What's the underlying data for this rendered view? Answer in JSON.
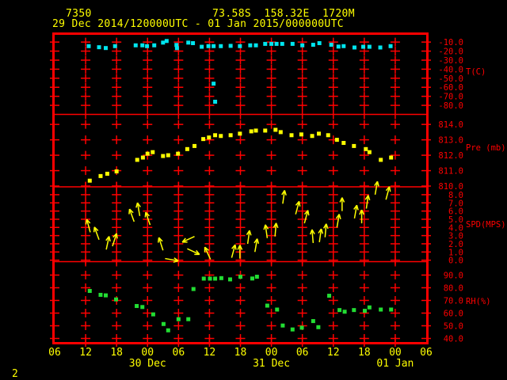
{
  "header": {
    "station_id": "7350",
    "location": "73.58S  158.32E  1720M",
    "period": "29 Dec 2014/120000UTC - 01 Jan 2015/000000UTC"
  },
  "footer": {
    "page_number": "2"
  },
  "colors": {
    "frame": "#ff0000",
    "axis_text": "#ff0000",
    "header_text": "#ffff00",
    "temperature_dots": "#00e5ee",
    "pressure_dots": "#ffff00",
    "wind_arrows": "#ffff00",
    "rh_dots": "#22dd33"
  },
  "x_axis": {
    "hours_span": 72,
    "tick_step_hours": 6,
    "tick_labels": [
      "06",
      "12",
      "18",
      "00",
      "06",
      "12",
      "18",
      "00",
      "06",
      "12",
      "18",
      "00",
      "06"
    ],
    "date_labels": [
      {
        "label": "30 Dec",
        "tick_index": 3
      },
      {
        "label": "31 Dec",
        "tick_index": 7
      },
      {
        "label": "01 Jan",
        "tick_index": 11
      }
    ]
  },
  "chart_data": [
    {
      "type": "scatter",
      "name": "temperature",
      "ylabel": "T(C)",
      "yticks": [
        -10,
        -20,
        -30,
        -40,
        -50,
        -60,
        -70,
        -80
      ],
      "ylim": [
        -2,
        -90
      ],
      "points": [
        [
          6.6,
          -14.5
        ],
        [
          8.6,
          -15.7
        ],
        [
          9.9,
          -16.6
        ],
        [
          11.7,
          -14.5
        ],
        [
          15.7,
          -13.6
        ],
        [
          17.0,
          -13.6
        ],
        [
          17.9,
          -14.5
        ],
        [
          19.3,
          -13.6
        ],
        [
          21.0,
          -10.6
        ],
        [
          21.7,
          -8.8
        ],
        [
          23.6,
          -13.2
        ],
        [
          23.7,
          -16.7
        ],
        [
          25.9,
          -10.6
        ],
        [
          26.8,
          -11.2
        ],
        [
          28.5,
          -15.2
        ],
        [
          29.8,
          -14.5
        ],
        [
          30.8,
          -14.5
        ],
        [
          32.2,
          -14.5
        ],
        [
          34.1,
          -14.2
        ],
        [
          35.9,
          -14.5
        ],
        [
          37.9,
          -13.6
        ],
        [
          39.0,
          -13.6
        ],
        [
          40.8,
          -12.0
        ],
        [
          42.0,
          -12.0
        ],
        [
          43.0,
          -12.0
        ],
        [
          44.1,
          -12.0
        ],
        [
          46.1,
          -12.0
        ],
        [
          48.0,
          -13.6
        ],
        [
          50.1,
          -13.0
        ],
        [
          51.3,
          -11.2
        ],
        [
          53.6,
          -13.0
        ],
        [
          55.0,
          -15.0
        ],
        [
          56.0,
          -14.5
        ],
        [
          58.1,
          -16.0
        ],
        [
          59.8,
          -15.2
        ],
        [
          61.0,
          -15.2
        ],
        [
          63.1,
          -16.0
        ],
        [
          65.1,
          -14.5
        ],
        [
          30.8,
          -56.0
        ],
        [
          31.1,
          -76.0
        ]
      ]
    },
    {
      "type": "scatter",
      "name": "pressure",
      "ylabel": "Pre (mb)",
      "yticks": [
        814,
        813,
        812,
        811,
        810
      ],
      "ylim": [
        814.65,
        809.95
      ],
      "points": [
        [
          6.8,
          810.35
        ],
        [
          8.9,
          810.65
        ],
        [
          10.2,
          810.8
        ],
        [
          12.0,
          810.95
        ],
        [
          16.0,
          811.7
        ],
        [
          17.1,
          811.85
        ],
        [
          18.0,
          812.1
        ],
        [
          19.0,
          812.2
        ],
        [
          21.0,
          811.95
        ],
        [
          22.0,
          812.0
        ],
        [
          23.9,
          812.1
        ],
        [
          25.7,
          812.4
        ],
        [
          27.1,
          812.6
        ],
        [
          28.8,
          813.05
        ],
        [
          29.9,
          813.15
        ],
        [
          31.1,
          813.3
        ],
        [
          32.2,
          813.25
        ],
        [
          34.1,
          813.3
        ],
        [
          35.9,
          813.4
        ],
        [
          38.1,
          813.55
        ],
        [
          39.0,
          813.6
        ],
        [
          40.8,
          813.6
        ],
        [
          42.8,
          813.65
        ],
        [
          43.8,
          813.5
        ],
        [
          45.9,
          813.3
        ],
        [
          47.8,
          813.35
        ],
        [
          49.9,
          813.25
        ],
        [
          51.2,
          813.4
        ],
        [
          53.0,
          813.3
        ],
        [
          54.7,
          813.0
        ],
        [
          56.0,
          812.8
        ],
        [
          58.0,
          812.6
        ],
        [
          60.3,
          812.4
        ],
        [
          61.0,
          812.2
        ],
        [
          63.2,
          811.7
        ],
        [
          65.2,
          811.85
        ]
      ]
    },
    {
      "type": "wind",
      "name": "wind-speed",
      "ylabel": "SPD(MPS)",
      "yticks": [
        8,
        7,
        6,
        5,
        4,
        3,
        2,
        1,
        0
      ],
      "ylim": [
        8.96,
        -0.18
      ],
      "arrows": [
        [
          6.9,
          3.4,
          -15
        ],
        [
          8.6,
          2.5,
          -20
        ],
        [
          10.0,
          1.3,
          12
        ],
        [
          11.2,
          1.7,
          18
        ],
        [
          15.4,
          4.7,
          -20
        ],
        [
          16.5,
          5.4,
          -10
        ],
        [
          18.5,
          4.3,
          -19
        ],
        [
          21.0,
          1.2,
          -18
        ],
        [
          21.4,
          0.2,
          100
        ],
        [
          25.7,
          1.4,
          115
        ],
        [
          27.1,
          2.9,
          245
        ],
        [
          30.2,
          0.1,
          -25
        ],
        [
          34.3,
          0.3,
          15
        ],
        [
          35.9,
          0.2,
          0
        ],
        [
          37.4,
          2.0,
          8
        ],
        [
          38.8,
          1.0,
          10
        ],
        [
          41.2,
          2.7,
          -8
        ],
        [
          42.7,
          2.9,
          5
        ],
        [
          44.2,
          6.9,
          8
        ],
        [
          46.7,
          5.6,
          15
        ],
        [
          48.4,
          4.5,
          15
        ],
        [
          50.1,
          2.1,
          -5
        ],
        [
          51.3,
          2.2,
          8
        ],
        [
          52.4,
          2.8,
          5
        ],
        [
          54.7,
          4.0,
          10
        ],
        [
          55.7,
          6.0,
          0
        ],
        [
          58.1,
          5.1,
          10
        ],
        [
          59.5,
          4.5,
          0
        ],
        [
          60.4,
          6.3,
          8
        ],
        [
          62.1,
          8.0,
          10
        ],
        [
          64.2,
          7.4,
          15
        ]
      ]
    },
    {
      "type": "scatter",
      "name": "relative-humidity",
      "ylabel": "RH(%)",
      "yticks": [
        90,
        80,
        70,
        60,
        50,
        40
      ],
      "ylim": [
        100.6,
        37.2
      ],
      "points": [
        [
          6.8,
          77.5
        ],
        [
          8.9,
          74.4
        ],
        [
          9.9,
          74.0
        ],
        [
          11.9,
          70.8
        ],
        [
          15.9,
          65.6
        ],
        [
          17.0,
          64.8
        ],
        [
          19.1,
          59.0
        ],
        [
          21.1,
          51.4
        ],
        [
          22.0,
          46.4
        ],
        [
          24.0,
          55.2
        ],
        [
          25.9,
          55.2
        ],
        [
          26.9,
          79.0
        ],
        [
          28.9,
          87.2
        ],
        [
          30.1,
          87.2
        ],
        [
          31.1,
          87.2
        ],
        [
          32.3,
          87.6
        ],
        [
          34.0,
          86.6
        ],
        [
          36.0,
          88.7
        ],
        [
          38.3,
          87.3
        ],
        [
          39.2,
          88.7
        ],
        [
          41.2,
          65.9
        ],
        [
          43.1,
          62.8
        ],
        [
          44.2,
          50.2
        ],
        [
          46.1,
          47.1
        ],
        [
          47.9,
          48.5
        ],
        [
          50.1,
          53.7
        ],
        [
          51.1,
          48.9
        ],
        [
          53.2,
          73.7
        ],
        [
          55.2,
          62.4
        ],
        [
          56.2,
          61.1
        ],
        [
          58.0,
          62.4
        ],
        [
          60.1,
          61.8
        ],
        [
          61.0,
          64.5
        ],
        [
          63.2,
          62.8
        ],
        [
          65.2,
          62.8
        ]
      ]
    }
  ]
}
